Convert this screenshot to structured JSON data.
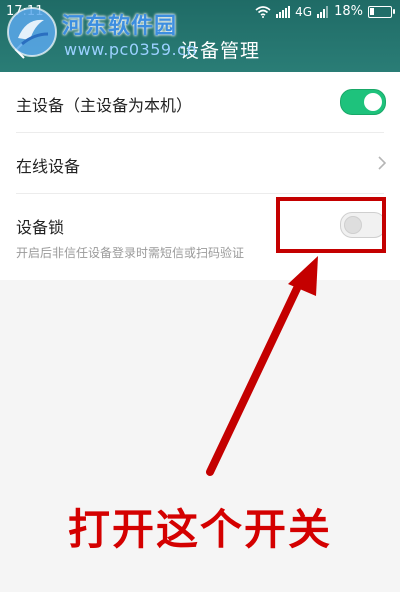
{
  "status_bar": {
    "time": "17:11",
    "network": "4G",
    "battery_percent": "18%",
    "battery_level": 0.18
  },
  "header": {
    "title": "设备管理",
    "back_icon": "chevron-left-icon"
  },
  "watermark": {
    "title": "河东软件园",
    "url": "www.pc0359.cn"
  },
  "settings": {
    "primary_device": {
      "label": "主设备（主设备为本机）",
      "toggle_on": true
    },
    "online_devices": {
      "label": "在线设备",
      "icon": "chevron-right-icon"
    },
    "device_lock": {
      "label": "设备锁",
      "description": "开启后非信任设备登录时需短信或扫码验证",
      "toggle_on": false
    }
  },
  "annotation": {
    "text": "打开这个开关",
    "color": "#d40000"
  },
  "colors": {
    "header": "#2a7d76",
    "toggle_on": "#1ec27c",
    "annotation": "#c40000"
  }
}
